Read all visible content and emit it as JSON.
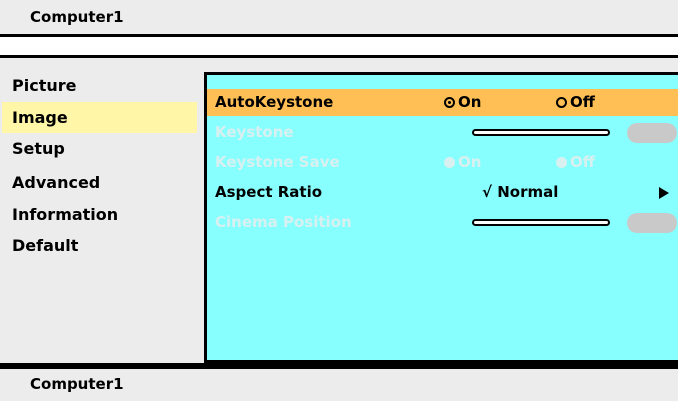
{
  "header": {
    "source": "Computer1"
  },
  "footer": {
    "source": "Computer1"
  },
  "menu": {
    "items": [
      "Picture",
      "Image",
      "Setup",
      "Advanced",
      "Information",
      "Default"
    ],
    "selected": "Image"
  },
  "submenu": {
    "auto_keystone": {
      "label": "AutoKeystone",
      "on": "On",
      "off": "Off",
      "value": "On"
    },
    "keystone": {
      "label": "Keystone"
    },
    "keystone_save": {
      "label": "Keystone Save",
      "on": "On",
      "off": "Off"
    },
    "aspect_ratio": {
      "label": "Aspect Ratio",
      "value": "√ Normal"
    },
    "cinema_position": {
      "label": "Cinema Position"
    }
  },
  "colors": {
    "panel": "#88ffff",
    "highlight": "#ffbf55",
    "selected_menu": "#fff6a8"
  }
}
